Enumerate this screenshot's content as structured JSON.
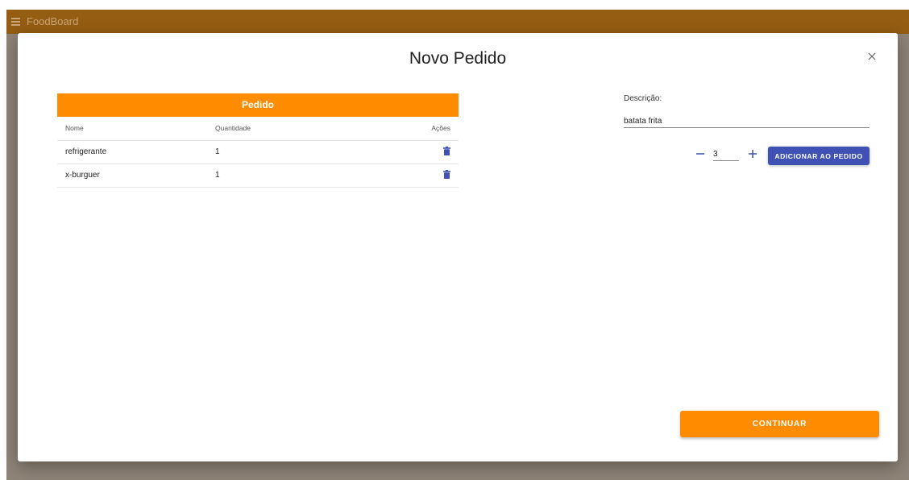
{
  "appbar": {
    "title": "FoodBoard",
    "menu_icon": "menu-icon",
    "background": "#955d12"
  },
  "dialog": {
    "title": "Novo Pedido",
    "close_icon": "close-icon"
  },
  "order": {
    "header": "Pedido",
    "header_color": "#ff8c00",
    "columns": {
      "name": "Nome",
      "quantity": "Quantidade",
      "actions": "Ações"
    },
    "rows": [
      {
        "name": "refrigerante",
        "quantity": "1",
        "action_icon": "trash-icon"
      },
      {
        "name": "x-burguer",
        "quantity": "1",
        "action_icon": "trash-icon"
      }
    ]
  },
  "form": {
    "description_label": "Descrição:",
    "description_value": "batata frita",
    "quantity_value": "3",
    "minus_icon": "minus-icon",
    "plus_icon": "plus-icon",
    "add_label": "ADICIONAR AO PEDIDO",
    "accent_color": "#3f51b5"
  },
  "footer": {
    "continue_label": "CONTINUAR"
  }
}
